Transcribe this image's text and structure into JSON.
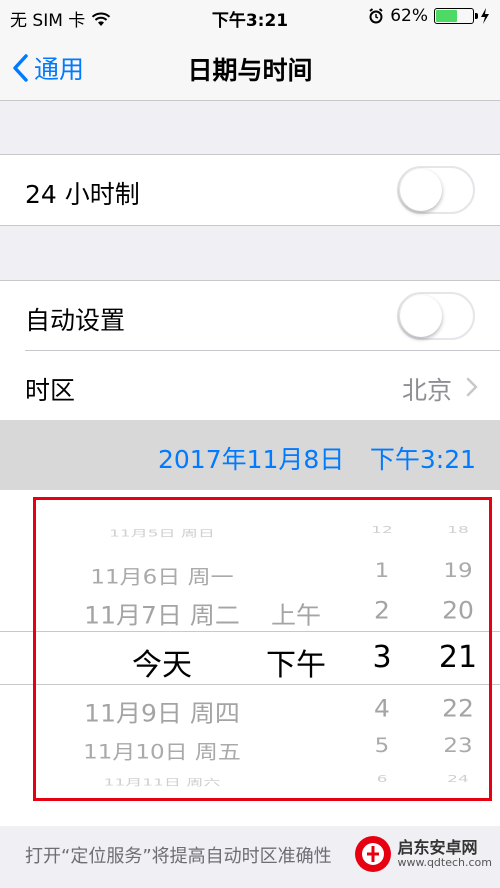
{
  "status_bar": {
    "carrier": "无 SIM 卡",
    "time": "下午3:21",
    "battery": "62%",
    "battery_level": 0.62
  },
  "nav": {
    "back_label": "通用",
    "title": "日期与时间"
  },
  "settings": {
    "hour24_label": "24 小时制",
    "hour24_on": false,
    "auto_label": "自动设置",
    "auto_on": false,
    "timezone_label": "时区",
    "timezone_value": "北京"
  },
  "current": {
    "date": "2017年11月8日",
    "time": "下午3:21"
  },
  "picker": {
    "rows": [
      {
        "date": "11月5日 周日",
        "ampm": "",
        "hour": "12",
        "minute": "18"
      },
      {
        "date": "11月6日 周一",
        "ampm": "",
        "hour": "1",
        "minute": "19"
      },
      {
        "date": "11月7日 周二",
        "ampm": "上午",
        "hour": "2",
        "minute": "20"
      },
      {
        "date": "今天",
        "ampm": "下午",
        "hour": "3",
        "minute": "21"
      },
      {
        "date": "11月9日 周四",
        "ampm": "",
        "hour": "4",
        "minute": "22"
      },
      {
        "date": "11月10日 周五",
        "ampm": "",
        "hour": "5",
        "minute": "23"
      },
      {
        "date": "11月11日 周六",
        "ampm": "",
        "hour": "6",
        "minute": "24"
      }
    ]
  },
  "footer": {
    "note": "打开“定位服务”将提高自动时区准确性"
  },
  "watermark": {
    "title": "启东安卓网",
    "url": "www.qdtech.com"
  },
  "colors": {
    "accent": "#007aff",
    "highlight": "#e60012"
  }
}
